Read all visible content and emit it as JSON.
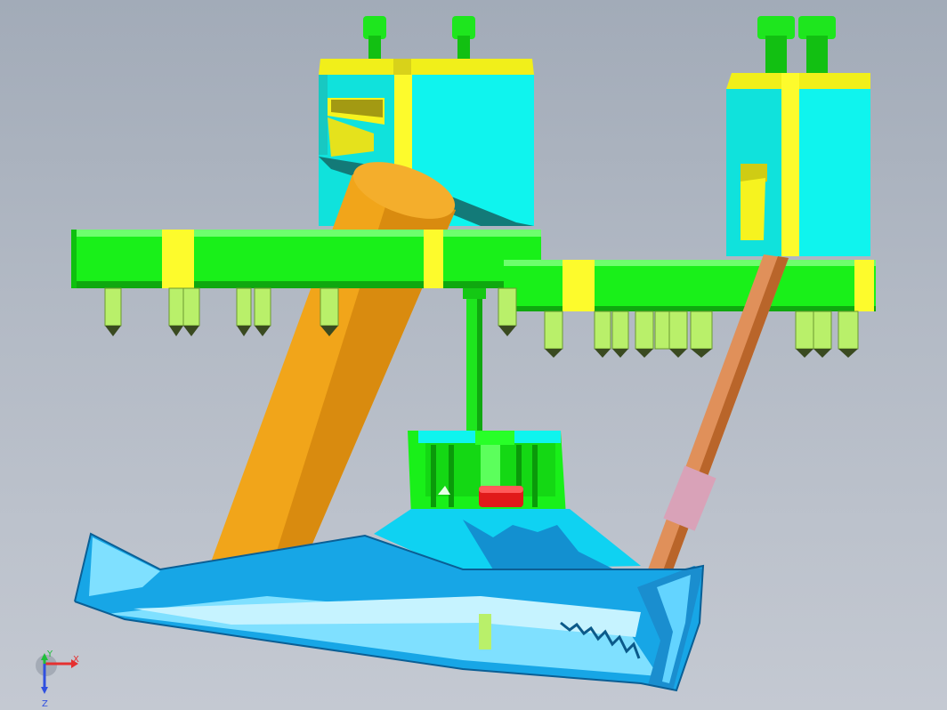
{
  "scene": {
    "view": "CAD 3D viewport",
    "background_color": "#a9b1bd",
    "colors": {
      "plate_green": "#19f019",
      "bushing_yellow": "#fdfb2c",
      "block_cyan": "#0ff4ee",
      "angled_pin_orange": "#f3a81a",
      "angled_pin_copper": "#d98a45",
      "part_blue": "#17a6e6",
      "part_light_blue": "#7fe0ff",
      "insert_red": "#e11a1a",
      "sleeve_pink": "#d9a2b8"
    }
  },
  "triad": {
    "x_label": "X",
    "y_label": "Y",
    "z_label": "Z",
    "x_color": "#e53030",
    "y_color": "#1fbf3a",
    "z_color": "#3050e0"
  }
}
